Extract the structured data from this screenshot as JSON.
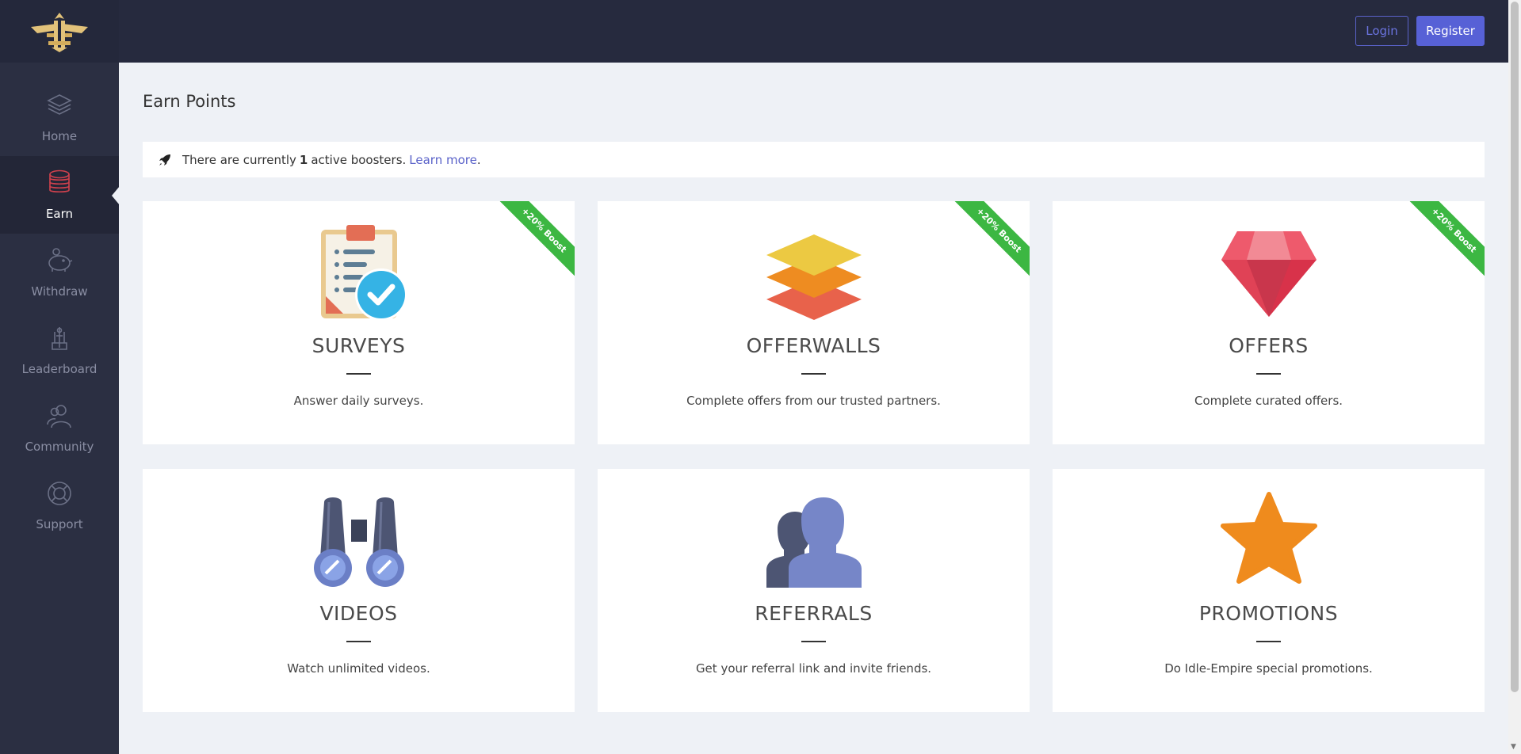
{
  "header": {
    "logo_icon": "idle-empire-eagle-logo",
    "login_label": "Login",
    "register_label": "Register"
  },
  "sidebar": {
    "items": [
      {
        "label": "Home",
        "icon": "layers-icon",
        "active": false
      },
      {
        "label": "Earn",
        "icon": "coins-icon",
        "active": true
      },
      {
        "label": "Withdraw",
        "icon": "piggy-bank-icon",
        "active": false
      },
      {
        "label": "Leaderboard",
        "icon": "trophy-icon",
        "active": false
      },
      {
        "label": "Community",
        "icon": "people-icon",
        "active": false
      },
      {
        "label": "Support",
        "icon": "lifebuoy-icon",
        "active": false
      }
    ]
  },
  "main": {
    "title": "Earn Points",
    "booster": {
      "icon": "rocket-icon",
      "prefix": "There are currently",
      "count": "1",
      "suffix": "active boosters.",
      "link": "Learn more",
      "end": "."
    },
    "cards": [
      {
        "title": "SURVEYS",
        "description": "Answer daily surveys.",
        "icon": "clipboard-check-icon",
        "ribbon": "+20% Boost"
      },
      {
        "title": "OFFERWALLS",
        "description": "Complete offers from our trusted partners.",
        "icon": "stacked-layers-icon",
        "ribbon": "+20% Boost"
      },
      {
        "title": "OFFERS",
        "description": "Complete curated offers.",
        "icon": "gem-icon",
        "ribbon": "+20% Boost"
      },
      {
        "title": "VIDEOS",
        "description": "Watch unlimited videos.",
        "icon": "binoculars-icon",
        "ribbon": ""
      },
      {
        "title": "REFERRALS",
        "description": "Get your referral link and invite friends.",
        "icon": "two-people-icon",
        "ribbon": ""
      },
      {
        "title": "PROMOTIONS",
        "description": "Do Idle-Empire special promotions.",
        "icon": "star-icon",
        "ribbon": ""
      }
    ]
  },
  "colors": {
    "topbar": "#262a3e",
    "sidebar": "#2b2f42",
    "accent": "#5761d6",
    "ribbon": "#3cb742",
    "page_bg": "#eef1f6"
  }
}
